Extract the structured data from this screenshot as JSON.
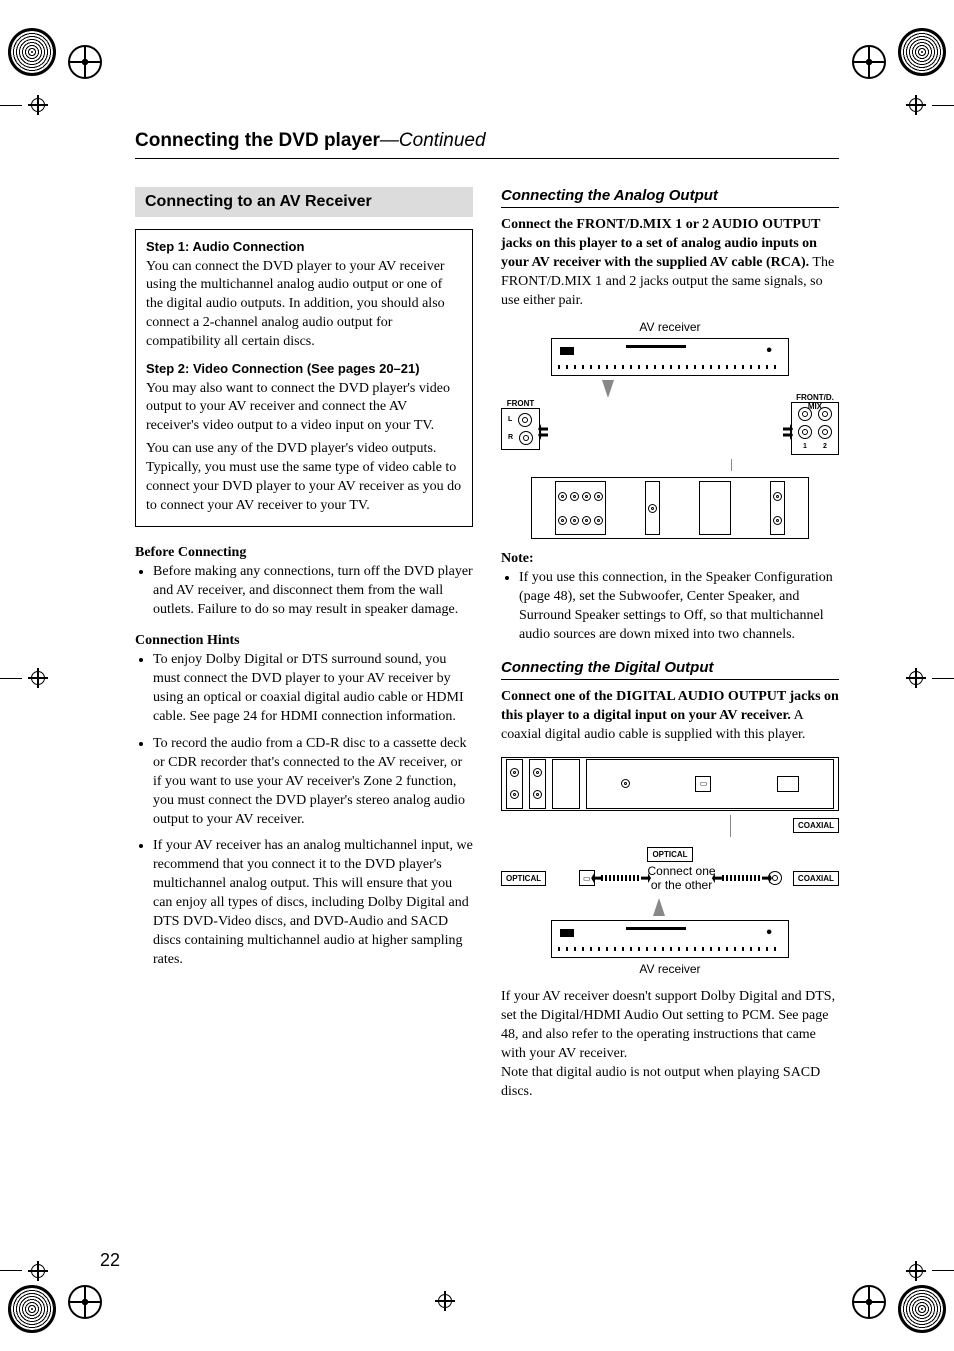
{
  "header": {
    "title_bold": "Connecting the DVD player",
    "title_cont": "—Continued"
  },
  "left": {
    "section_title": "Connecting to an AV Receiver",
    "step1_heading": "Step 1: Audio Connection",
    "step1_body": "You can connect the DVD player to your AV receiver using the multichannel analog audio output or one of the digital audio outputs. In addition, you should also connect a 2-channel analog audio output for compatibility all certain discs.",
    "step2_heading": "Step 2: Video Connection (See pages 20–21)",
    "step2_body1": "You may also want to connect the DVD player's video output to your AV receiver and connect the AV receiver's video output to a video input on your TV.",
    "step2_body2": "You can use any of the DVD player's video outputs. Typically, you must use the same type of video cable to connect your DVD player to your AV receiver as you do to connect your AV receiver to your TV.",
    "before_heading": "Before Connecting",
    "before_bullet": "Before making any connections, turn off the DVD player and AV receiver, and disconnect them from the wall outlets. Failure to do so may result in speaker damage.",
    "hints_heading": "Connection Hints",
    "hints": [
      "To enjoy Dolby Digital or DTS surround sound, you must connect the DVD player to your AV receiver by using an optical or coaxial digital audio cable or HDMI cable. See page 24 for HDMI connection information.",
      "To record the audio from a CD-R disc to a cassette deck or CDR recorder that's connected to the AV receiver, or if you want to use your AV receiver's Zone 2 function, you must connect the DVD player's stereo analog audio output to your AV receiver.",
      "If your AV receiver has an analog multichannel input, we recommend that you connect it to the DVD player's multichannel analog output. This will ensure that you can enjoy all types of discs, including Dolby Digital and DTS DVD-Video discs, and DVD-Audio and SACD discs containing multichannel audio at higher sampling rates."
    ]
  },
  "right": {
    "analog_heading": "Connecting the Analog Output",
    "analog_bold": "Connect the FRONT/D.MIX 1 or 2 AUDIO OUTPUT jacks on this player to a set of analog audio inputs on your AV receiver with the supplied AV cable (RCA).",
    "analog_rest": " The FRONT/D.MIX 1 and 2 jacks output the same signals, so use either pair.",
    "diagram1": {
      "av_receiver": "AV receiver",
      "front": "FRONT",
      "l": "L",
      "r": "R",
      "front_dmix": "FRONT/D. MIX",
      "n1": "1",
      "n2": "2"
    },
    "note_heading": "Note:",
    "note_bullet": "If you use this connection, in the Speaker Configuration (page 48), set the Subwoofer, Center Speaker, and Surround Speaker settings to Off, so that multichannel audio sources are down mixed into two channels.",
    "digital_heading": "Connecting the Digital Output",
    "digital_bold": "Connect one of the DIGITAL AUDIO OUTPUT jacks on this player to a digital input on your AV receiver.",
    "digital_rest": " A coaxial digital audio cable is supplied with this player.",
    "diagram2": {
      "coaxial": "COAXIAL",
      "optical": "OPTICAL",
      "connect_one": "Connect one",
      "or_other": "or the other",
      "av_receiver": "AV receiver"
    },
    "digital_p1": "If your AV receiver doesn't support Dolby Digital and DTS, set the Digital/HDMI Audio Out setting to PCM. See page 48, and also refer to the operating instructions that came with your AV receiver.",
    "digital_p2": "Note that digital audio is not output when playing SACD discs."
  },
  "page_number": "22"
}
